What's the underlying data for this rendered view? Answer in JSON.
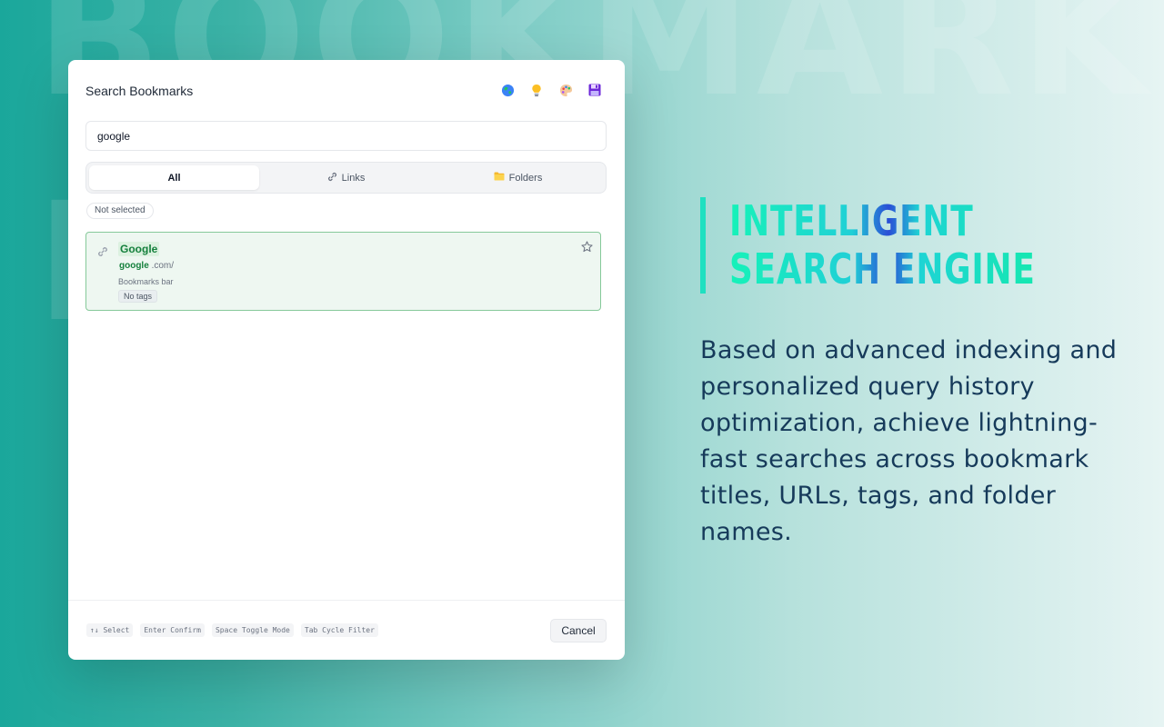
{
  "background": {
    "watermark_line1": "BOOKMARK",
    "watermark_line2": "E"
  },
  "modal": {
    "title": "Search Bookmarks",
    "toolbar_icons": [
      "globe-icon",
      "lightbulb-icon",
      "palette-icon",
      "floppy-disk-icon"
    ],
    "search": {
      "value": "google",
      "placeholder": ""
    },
    "tabs": [
      {
        "label": "All",
        "icon": "",
        "active": true
      },
      {
        "label": "Links",
        "icon": "link-icon",
        "active": false
      },
      {
        "label": "Folders",
        "icon": "folder-icon",
        "active": false
      }
    ],
    "filter_chip": "Not selected",
    "results": [
      {
        "title": "Google",
        "url_match": "google",
        "url_rest": ".com/",
        "folder": "Bookmarks bar",
        "tag": "No tags"
      }
    ],
    "shortcuts": [
      "↑↓ Select",
      "Enter Confirm",
      "Space Toggle Mode",
      "Tab Cycle Filter"
    ],
    "cancel_label": "Cancel"
  },
  "promo": {
    "heading_line1": "INTELLIGENT",
    "heading_line2": "SEARCH ENGINE",
    "body": "Based on advanced indexing and personalized query history optimization, achieve lightning-fast searches across bookmark titles, URLs, tags, and folder names."
  },
  "colors": {
    "accent_green": "#15803d",
    "card_border": "#86c99a",
    "heading_gradient_start": "#16f2b8",
    "heading_gradient_mid": "#2a4fd6",
    "body_text": "#163a5a"
  }
}
